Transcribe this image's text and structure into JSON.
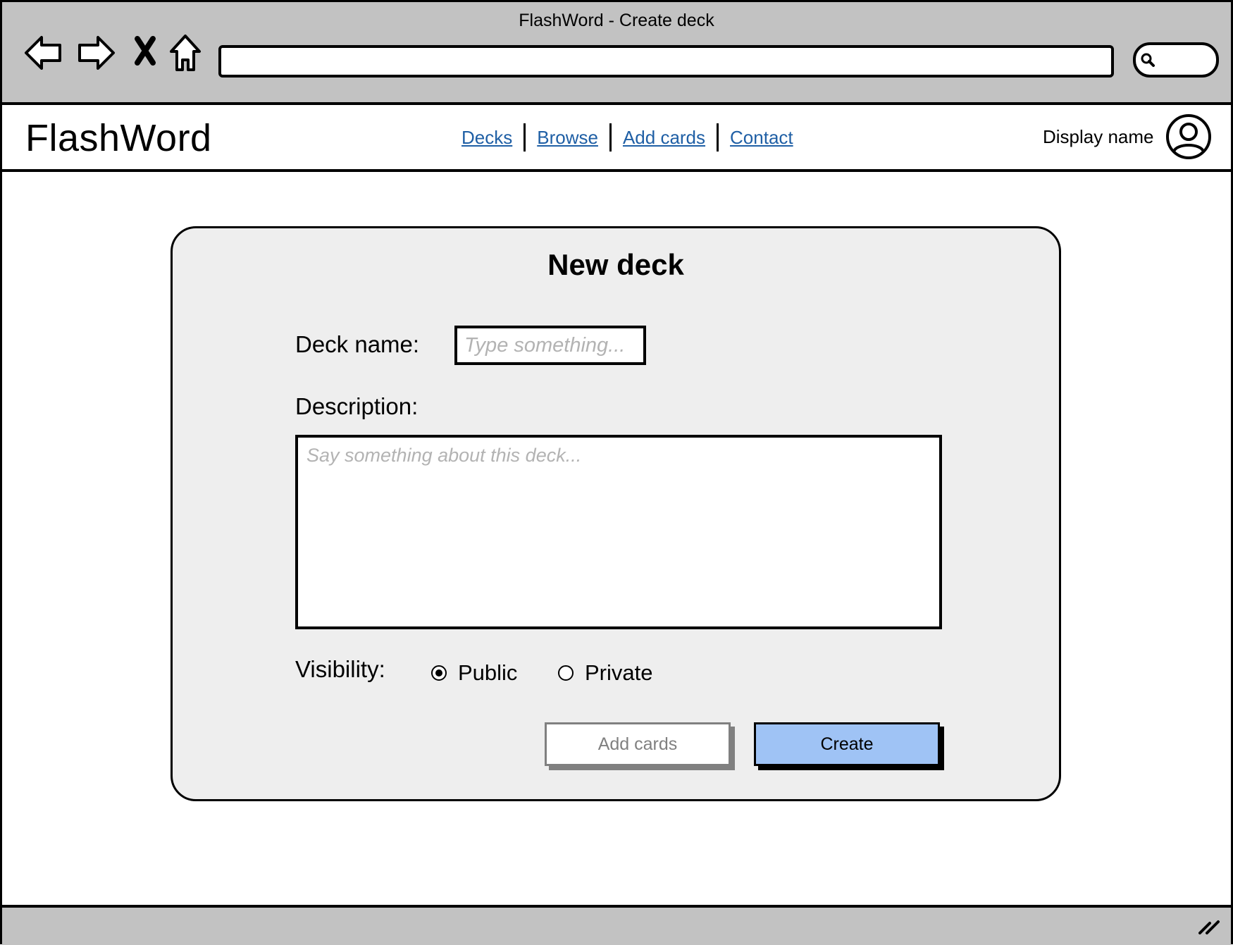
{
  "window": {
    "title": "FlashWord - Create deck"
  },
  "browser": {
    "icons": [
      "back-arrow-icon",
      "forward-arrow-icon",
      "close-icon",
      "home-icon",
      "search-icon"
    ]
  },
  "header": {
    "logo": "FlashWord",
    "nav": [
      {
        "label": "Decks"
      },
      {
        "label": "Browse"
      },
      {
        "label": "Add cards"
      },
      {
        "label": "Contact"
      }
    ],
    "display_name": "Display name",
    "avatar_icon": "user-avatar-icon"
  },
  "form": {
    "title": "New deck",
    "deck_name_label": "Deck name:",
    "deck_name_placeholder": "Type something...",
    "description_label": "Description:",
    "description_placeholder": "Say something about this deck...",
    "visibility_label": "Visibility:",
    "visibility_options": [
      {
        "label": "Public",
        "selected": true
      },
      {
        "label": "Private",
        "selected": false
      }
    ],
    "add_cards_button": "Add cards",
    "create_button": "Create"
  },
  "colors": {
    "chrome": "#c2c2c2",
    "card_bg": "#eeeeee",
    "link": "#1f5fa5",
    "primary_button": "#9fc3f5",
    "disabled_text": "#808080",
    "placeholder": "#b3b3b3"
  }
}
